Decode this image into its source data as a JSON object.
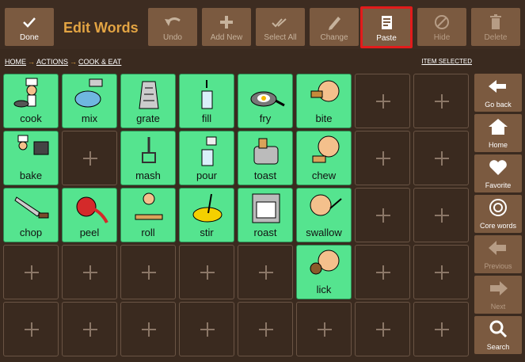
{
  "toolbar": {
    "done_label": "Done",
    "title": "Edit Words",
    "undo_label": "Undo",
    "add_new_label": "Add New",
    "select_all_label": "Select All",
    "change_label": "Change",
    "paste_label": "Paste",
    "hide_label": "Hide",
    "delete_label": "Delete"
  },
  "breadcrumb": {
    "home": "HOME",
    "actions": "ACTIONS",
    "cook_eat": "COOK & EAT",
    "arrow": "→"
  },
  "item_selected": "ITEM SELECTED",
  "words": {
    "cook": "cook",
    "mix": "mix",
    "grate": "grate",
    "fill": "fill",
    "fry": "fry",
    "bite": "bite",
    "bake": "bake",
    "mash": "mash",
    "pour": "pour",
    "toast": "toast",
    "chew": "chew",
    "chop": "chop",
    "peel": "peel",
    "roll": "roll",
    "stir": "stir",
    "roast": "roast",
    "swallow": "swallow",
    "lick": "lick"
  },
  "side": {
    "go_back": "Go back",
    "home": "Home",
    "favorite": "Favorite",
    "core_words": "Core words",
    "previous": "Previous",
    "next": "Next",
    "search": "Search"
  }
}
